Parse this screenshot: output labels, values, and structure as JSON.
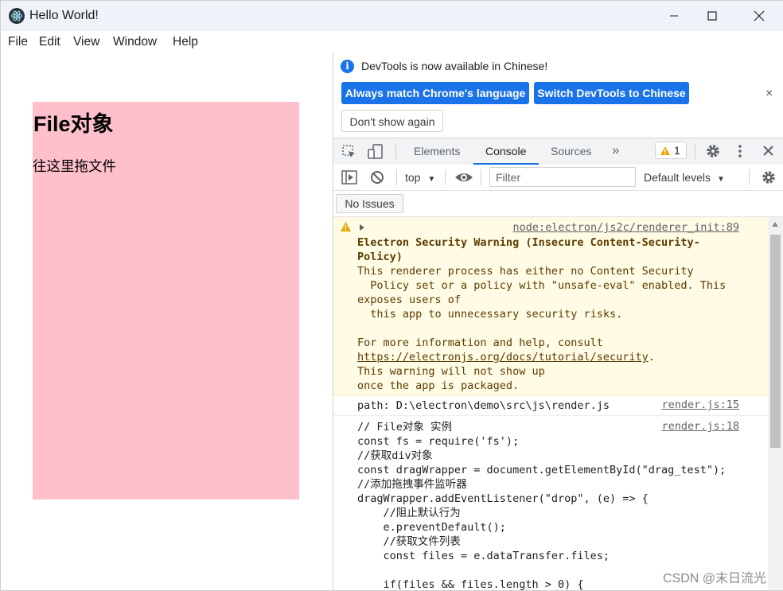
{
  "window": {
    "title": "Hello World!",
    "menu": [
      "File",
      "Edit",
      "View",
      "Window",
      "Help"
    ]
  },
  "page": {
    "heading": "File对象",
    "drop_text": "往这里拖文件",
    "drop_zone_color": "#ffc0cb"
  },
  "devtools": {
    "language_banner": {
      "message": "DevTools is now available in Chinese!",
      "match_button": "Always match Chrome's language",
      "switch_button": "Switch DevTools to Chinese",
      "dismiss_button": "Don't show again",
      "close_icon": "×"
    },
    "tabs": [
      {
        "label": "Elements",
        "active": false
      },
      {
        "label": "Console",
        "active": true
      },
      {
        "label": "Sources",
        "active": false
      }
    ],
    "more_tabs": "»",
    "warning_count": "1",
    "context_selector": "top",
    "filter_placeholder": "Filter",
    "levels_label": "Default levels",
    "issues_button": "No Issues",
    "accent_color": "#1a73e8",
    "console": {
      "warning": {
        "source": "node:electron/js2c/renderer_init:89",
        "title_lines": [
          "Electron Security Warning (Insecure Content-Security-",
          "Policy)"
        ],
        "body_lines": [
          "This renderer process has either no Content Security",
          "  Policy set or a policy with \"unsafe-eval\" enabled. This",
          "exposes users of",
          "  this app to unnecessary security risks.",
          "",
          "For more information and help, consult"
        ],
        "link": "https://electronjs.org/docs/tutorial/security",
        "link_suffix": ".",
        "tail_lines": [
          "This warning will not show up",
          "once the app is packaged."
        ]
      },
      "path_log": {
        "text": "path: D:\\electron\\demo\\src\\js\\render.js",
        "source": "render.js:15"
      },
      "code_log": {
        "source": "render.js:18",
        "lines": [
          "// File对象 实例",
          "const fs = require('fs');",
          "//获取div对象",
          "const dragWrapper = document.getElementById(\"drag_test\");",
          "//添加拖拽事件监听器",
          "dragWrapper.addEventListener(\"drop\", (e) => {",
          "    //阻止默认行为",
          "    e.preventDefault();",
          "    //获取文件列表",
          "    const files = e.dataTransfer.files;",
          "",
          "    if(files && files.length > 0) {"
        ]
      }
    }
  },
  "watermark": "CSDN @末日流光"
}
